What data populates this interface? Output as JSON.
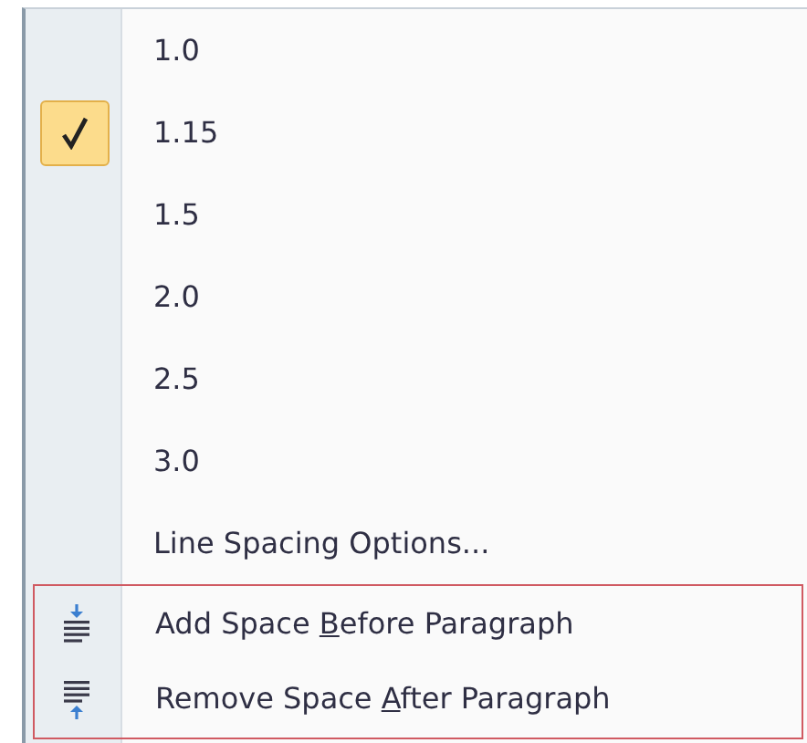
{
  "menu": {
    "items": [
      {
        "kind": "spacing",
        "label": "1.0",
        "selected": false
      },
      {
        "kind": "spacing",
        "label": "1.15",
        "selected": true
      },
      {
        "kind": "spacing",
        "label": "1.5",
        "selected": false
      },
      {
        "kind": "spacing",
        "label": "2.0",
        "selected": false
      },
      {
        "kind": "spacing",
        "label": "2.5",
        "selected": false
      },
      {
        "kind": "spacing",
        "label": "3.0",
        "selected": false
      },
      {
        "kind": "option",
        "label": "Line Spacing Options..."
      }
    ],
    "highlighted_group": {
      "highlighted": true,
      "items": [
        {
          "kind": "space-before",
          "before": "Add Space ",
          "key": "B",
          "after": "efore Paragraph"
        },
        {
          "kind": "space-after",
          "before": "Remove Space ",
          "key": "A",
          "after": "fter Paragraph"
        }
      ]
    }
  }
}
